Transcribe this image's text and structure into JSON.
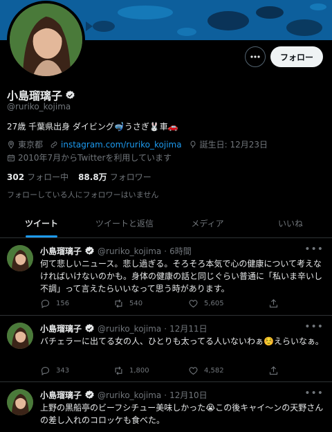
{
  "profile": {
    "name": "小島瑠璃子",
    "handle": "@ruriko_kojima",
    "bio": "27歳 千葉県出身 ダイビング🤿うさぎ🐰車🚗",
    "location": "東京都",
    "website": "instagram.com/ruriko_kojima",
    "birthday": "誕生日: 12月23日",
    "joined": "2010年7月からTwitterを利用しています",
    "following_count": "302",
    "following_label": "フォロー中",
    "followers_count": "88.8万",
    "followers_label": "フォロワー",
    "no_mutual": "フォローしている人にフォロワーはいません"
  },
  "actions": {
    "follow_label": "フォロー",
    "more_label": "•••"
  },
  "tabs": [
    {
      "label": "ツイート",
      "active": true
    },
    {
      "label": "ツイートと返信",
      "active": false
    },
    {
      "label": "メディア",
      "active": false
    },
    {
      "label": "いいね",
      "active": false
    }
  ],
  "tweets": [
    {
      "name": "小島瑠璃子",
      "handle": "@ruriko_kojima",
      "date": "6時間",
      "text": "何て悲しいニュース。悲し過ぎる。そろそろ本気で心の健康について考えなければいけないのかも。身体の健康の話と同じぐらい普通に「私いま辛いし不調」って言えたらいいなって思う時があります。",
      "replies": "156",
      "retweets": "540",
      "likes": "5,605"
    },
    {
      "name": "小島瑠璃子",
      "handle": "@ruriko_kojima",
      "date": "12月11日",
      "text": "バチェラーに出てる女の人、ひとりも太ってる人いないわぁ☺️えらいなぁ。",
      "replies": "343",
      "retweets": "1,800",
      "likes": "4,582"
    },
    {
      "name": "小島瑠璃子",
      "handle": "@ruriko_kojima",
      "date": "12月10日",
      "text": "上野の黒船亭のビーフシチュー美味しかった😭この後キャイ〜ンの天野さんの差し入れのコロッケも食べた。",
      "replies": "",
      "retweets": "",
      "likes": ""
    }
  ],
  "colors": {
    "accent": "#1d9bf0",
    "background": "#000000",
    "muted": "#71767b"
  }
}
